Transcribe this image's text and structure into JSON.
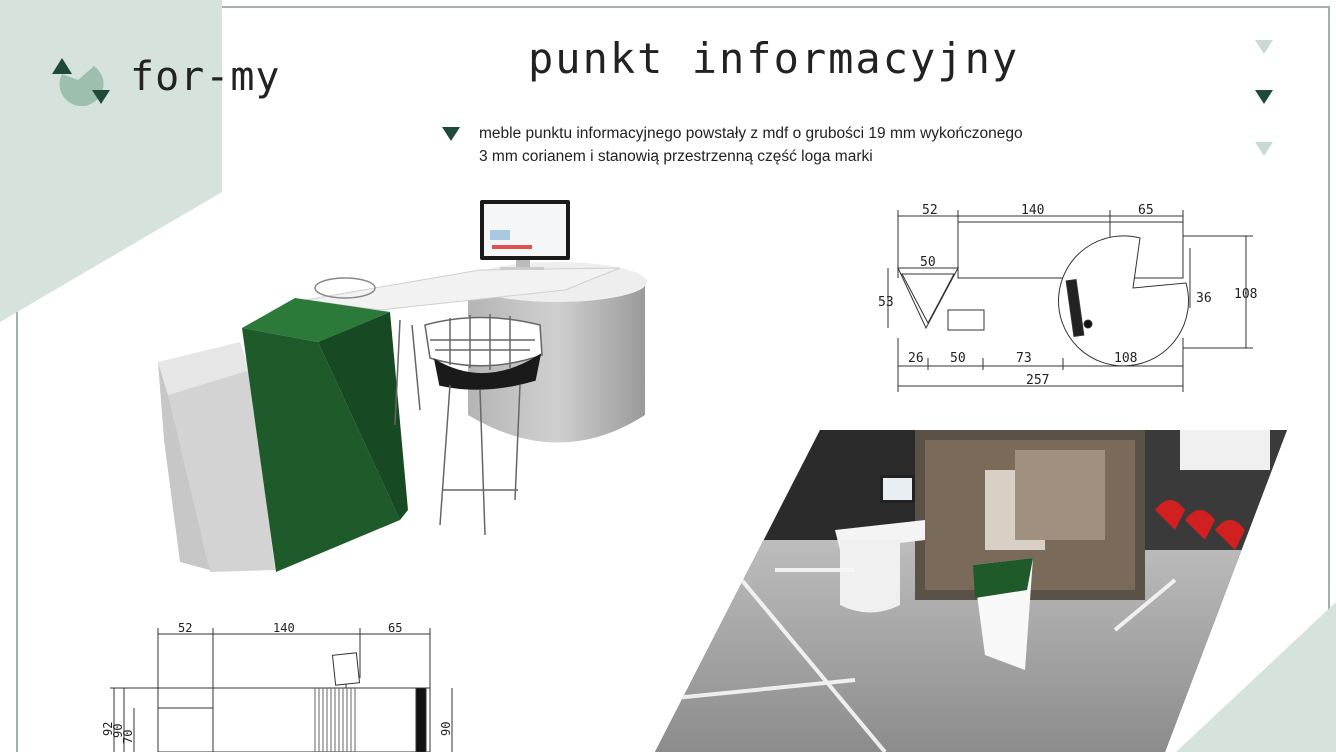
{
  "brand": {
    "name": "for-my"
  },
  "page": {
    "title": "punkt informacyjny"
  },
  "description": {
    "line1": "meble punktu informacyjnego powstały z mdf o grubości 19 mm wykończonego",
    "line2": "3 mm corianem  i stanowią przestrzenną część loga marki"
  },
  "colors": {
    "accent": "#1f4a3a",
    "accent_light": "#c8dad2",
    "panel": "#d6e2dc",
    "desk_green": "#1e5a2a"
  },
  "top_plan": {
    "dims": {
      "w52": "52",
      "w140": "140",
      "w65": "65",
      "w50": "50",
      "h53": "53",
      "h36": "36",
      "h108": "108",
      "b26": "26",
      "b50": "50",
      "b73": "73",
      "b108": "108",
      "total": "257"
    }
  },
  "front_elev": {
    "dims": {
      "w52": "52",
      "w140": "140",
      "w65": "65",
      "h92": "92",
      "h90": "90",
      "h70": "70",
      "h90r": "90"
    }
  },
  "icons": [
    "logo-icon",
    "nav-triangle-icon",
    "bullet-triangle-icon"
  ]
}
